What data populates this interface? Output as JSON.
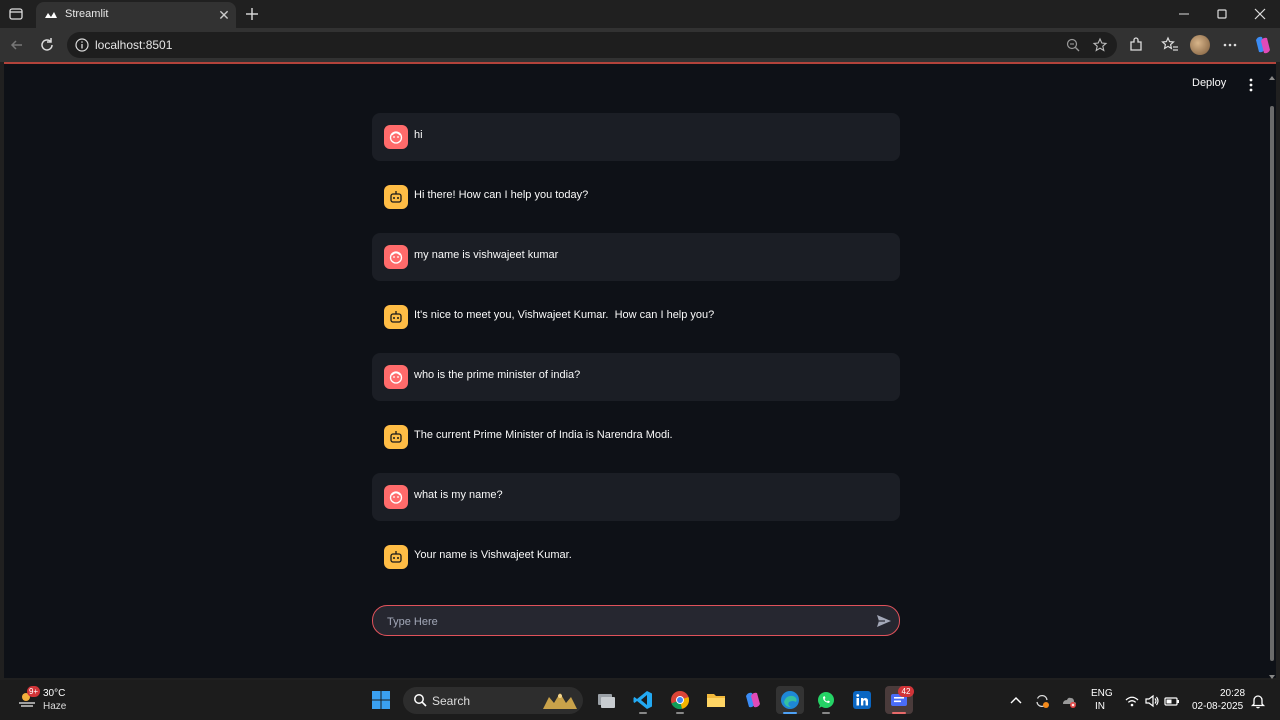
{
  "browser": {
    "tab_title": "Streamlit",
    "url": "localhost:8501"
  },
  "app": {
    "deploy_label": "Deploy",
    "messages": [
      {
        "role": "user",
        "text": "hi"
      },
      {
        "role": "assistant",
        "text": "Hi there! How can I help you today?"
      },
      {
        "role": "user",
        "text": "my name is vishwajeet kumar"
      },
      {
        "role": "assistant",
        "text": "It's nice to meet you, Vishwajeet Kumar.  How can I help you?"
      },
      {
        "role": "user",
        "text": "who is the prime minister of india?"
      },
      {
        "role": "assistant",
        "text": "The current Prime Minister of India is Narendra Modi."
      },
      {
        "role": "user",
        "text": "what is my name?"
      },
      {
        "role": "assistant",
        "text": "Your name is Vishwajeet Kumar."
      }
    ],
    "chat_input": {
      "placeholder": "Type Here",
      "value": ""
    },
    "colors": {
      "background": "#0e1117",
      "user_avatar": "#ff6b6b",
      "assistant_avatar": "#ffbd45",
      "user_bubble": "#1b1e25",
      "input_border": "#e0525b"
    }
  },
  "taskbar": {
    "weather": {
      "temp": "30°C",
      "condition": "Haze",
      "badge": "9+"
    },
    "search_label": "Search",
    "teams_badge": "42",
    "language": {
      "line1": "ENG",
      "line2": "IN"
    },
    "clock": {
      "time": "20:28",
      "date": "02-08-2025"
    },
    "pinned_apps": [
      "file-explorer-task-view",
      "vscode",
      "chrome",
      "file-explorer",
      "copilot",
      "edge",
      "whatsapp",
      "linkedin",
      "teams"
    ]
  }
}
